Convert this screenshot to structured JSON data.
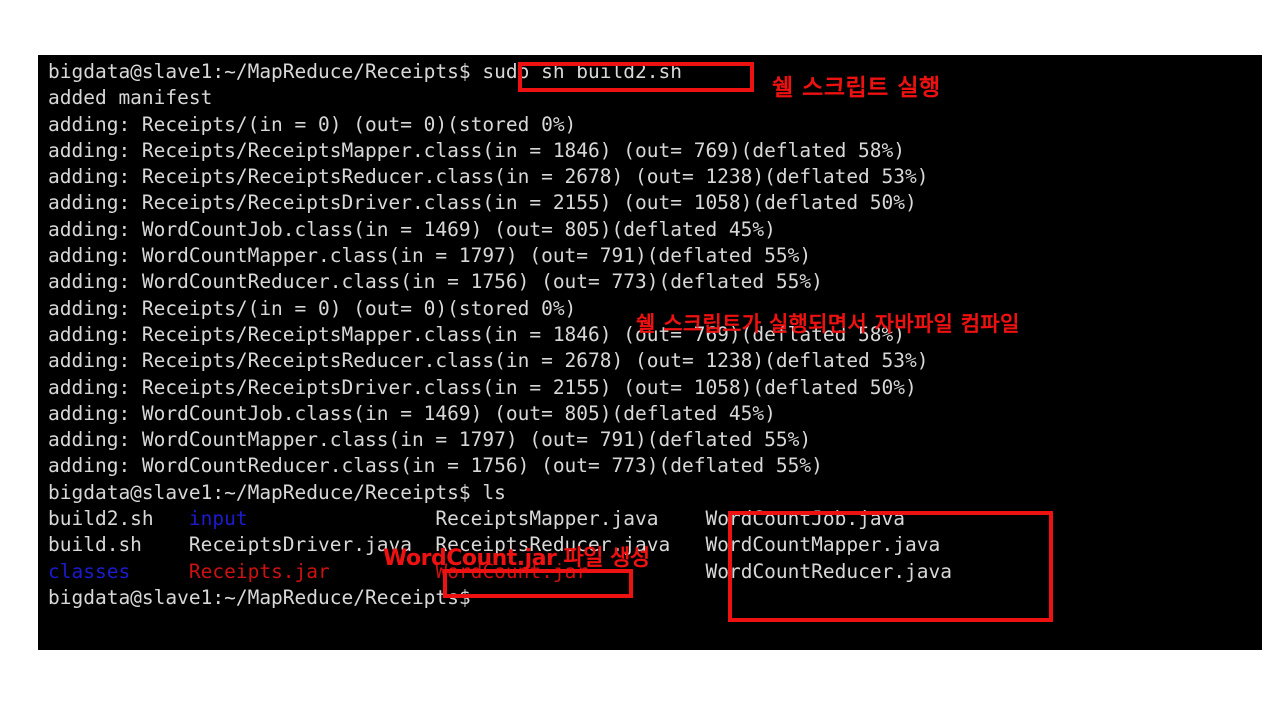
{
  "terminal": {
    "prompt": "bigdata@slave1:~/MapReduce/Receipts$",
    "lines": [
      {
        "id": "prompt-build",
        "segments": [
          {
            "text": "bigdata@slave1:~/MapReduce/Receipts$ sudo sh build2.sh",
            "color": "white"
          }
        ]
      },
      {
        "id": "added-manifest",
        "segments": [
          {
            "text": "added manifest",
            "color": "white"
          }
        ]
      },
      {
        "id": "adding-1",
        "segments": [
          {
            "text": "adding: Receipts/(in = 0) (out= 0)(stored 0%)",
            "color": "white"
          }
        ]
      },
      {
        "id": "adding-2",
        "segments": [
          {
            "text": "adding: Receipts/ReceiptsMapper.class(in = 1846) (out= 769)(deflated 58%)",
            "color": "white"
          }
        ]
      },
      {
        "id": "adding-3",
        "segments": [
          {
            "text": "adding: Receipts/ReceiptsReducer.class(in = 2678) (out= 1238)(deflated 53%)",
            "color": "white"
          }
        ]
      },
      {
        "id": "adding-4",
        "segments": [
          {
            "text": "adding: Receipts/ReceiptsDriver.class(in = 2155) (out= 1058)(deflated 50%)",
            "color": "white"
          }
        ]
      },
      {
        "id": "adding-5",
        "segments": [
          {
            "text": "adding: WordCountJob.class(in = 1469) (out= 805)(deflated 45%)",
            "color": "white"
          }
        ]
      },
      {
        "id": "adding-6",
        "segments": [
          {
            "text": "adding: WordCountMapper.class(in = 1797) (out= 791)(deflated 55%)",
            "color": "white"
          }
        ]
      },
      {
        "id": "adding-7",
        "segments": [
          {
            "text": "adding: WordCountReducer.class(in = 1756) (out= 773)(deflated 55%)",
            "color": "white"
          }
        ]
      },
      {
        "id": "adding-8",
        "segments": [
          {
            "text": "adding: Receipts/(in = 0) (out= 0)(stored 0%)",
            "color": "white"
          }
        ]
      },
      {
        "id": "adding-9",
        "segments": [
          {
            "text": "adding: Receipts/ReceiptsMapper.class(in = 1846) (out= 769)(deflated 58%)",
            "color": "white"
          }
        ]
      },
      {
        "id": "adding-10",
        "segments": [
          {
            "text": "adding: Receipts/ReceiptsReducer.class(in = 2678) (out= 1238)(deflated 53%)",
            "color": "white"
          }
        ]
      },
      {
        "id": "adding-11",
        "segments": [
          {
            "text": "adding: Receipts/ReceiptsDriver.class(in = 2155) (out= 1058)(deflated 50%)",
            "color": "white"
          }
        ]
      },
      {
        "id": "adding-12",
        "segments": [
          {
            "text": "adding: WordCountJob.class(in = 1469) (out= 805)(deflated 45%)",
            "color": "white"
          }
        ]
      },
      {
        "id": "adding-13",
        "segments": [
          {
            "text": "adding: WordCountMapper.class(in = 1797) (out= 791)(deflated 55%)",
            "color": "white"
          }
        ]
      },
      {
        "id": "adding-14",
        "segments": [
          {
            "text": "adding: WordCountReducer.class(in = 1756) (out= 773)(deflated 55%)",
            "color": "white"
          }
        ]
      },
      {
        "id": "prompt-ls",
        "segments": [
          {
            "text": "bigdata@slave1:~/MapReduce/Receipts$ ls",
            "color": "white"
          }
        ]
      },
      {
        "id": "ls-row-1",
        "segments": [
          {
            "text": "build2.sh   ",
            "color": "white"
          },
          {
            "text": "input",
            "color": "blue"
          },
          {
            "text": "                ReceiptsMapper.java    WordCountJob.java",
            "color": "white"
          }
        ]
      },
      {
        "id": "ls-row-2",
        "segments": [
          {
            "text": "build.sh    ReceiptsDriver.java  ReceiptsReducer.java   WordCountMapper.java",
            "color": "white"
          }
        ]
      },
      {
        "id": "ls-row-3",
        "segments": [
          {
            "text": "classes",
            "color": "blue"
          },
          {
            "text": "     ",
            "color": "white"
          },
          {
            "text": "Receipts.jar",
            "color": "red"
          },
          {
            "text": "         ",
            "color": "white"
          },
          {
            "text": "WordCount.jar",
            "color": "red"
          },
          {
            "text": "          WordCountReducer.java",
            "color": "white"
          }
        ]
      },
      {
        "id": "prompt-final",
        "segments": [
          {
            "text": "bigdata@slave1:~/MapReduce/Receipts$",
            "color": "white"
          }
        ]
      }
    ]
  },
  "annotations": {
    "accent_color": "#ee1111",
    "texts": [
      {
        "id": "anno-shell-run",
        "label": "쉘 스크립트 실행"
      },
      {
        "id": "anno-compile",
        "label": "쉘 스크립트가 실행되면서 자바파일 컴파일"
      },
      {
        "id": "anno-jar-created",
        "label": "WordCount.jar 파일 생성"
      }
    ],
    "boxes": [
      {
        "id": "anno-box-cmd",
        "target": "sudo sh build2.sh"
      },
      {
        "id": "anno-box-jar",
        "target": "WordCount.jar"
      },
      {
        "id": "anno-box-wcfiles",
        "target": "WordCountJob.java / WordCountMapper.java / WordCountReducer.java"
      }
    ]
  }
}
